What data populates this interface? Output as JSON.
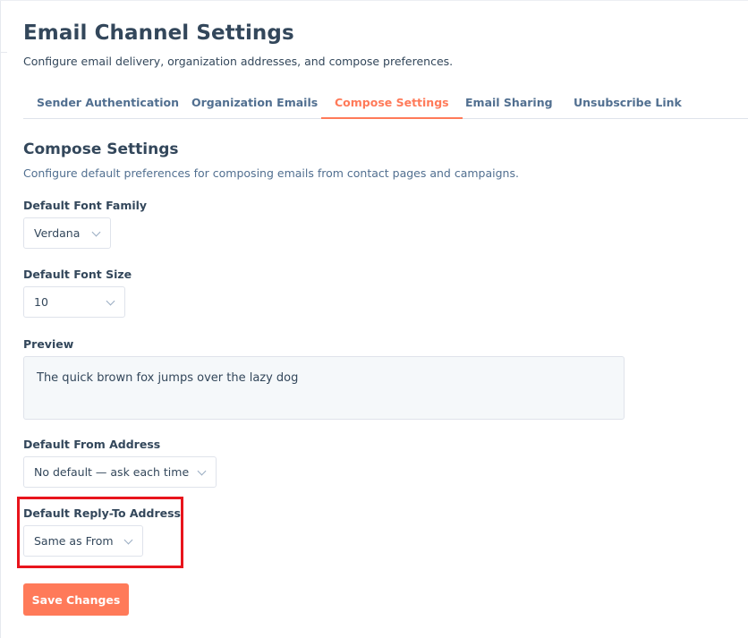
{
  "header": {
    "title": "Email Channel Settings",
    "subtitle": "Configure email delivery, organization addresses, and compose preferences."
  },
  "tabs": [
    {
      "label": "Sender Authentication",
      "active": false
    },
    {
      "label": "Organization Emails",
      "active": false
    },
    {
      "label": "Compose Settings",
      "active": true
    },
    {
      "label": "Email Sharing",
      "active": false
    },
    {
      "label": "Unsubscribe Link",
      "active": false
    }
  ],
  "section": {
    "title": "Compose Settings",
    "description": "Configure default preferences for composing emails from contact pages and campaigns."
  },
  "fields": {
    "font_family": {
      "label": "Default Font Family",
      "value": "Verdana"
    },
    "font_size": {
      "label": "Default Font Size",
      "value": "10"
    },
    "preview": {
      "label": "Preview",
      "text": "The quick brown fox jumps over the lazy dog"
    },
    "from_address": {
      "label": "Default From Address",
      "value": "No default — ask each time"
    },
    "reply_to": {
      "label": "Default Reply-To Address",
      "value": "Same as From"
    }
  },
  "actions": {
    "save_label": "Save Changes"
  },
  "colors": {
    "accent": "#ff7a59",
    "highlight": "#e8141c",
    "text": "#33475b"
  }
}
